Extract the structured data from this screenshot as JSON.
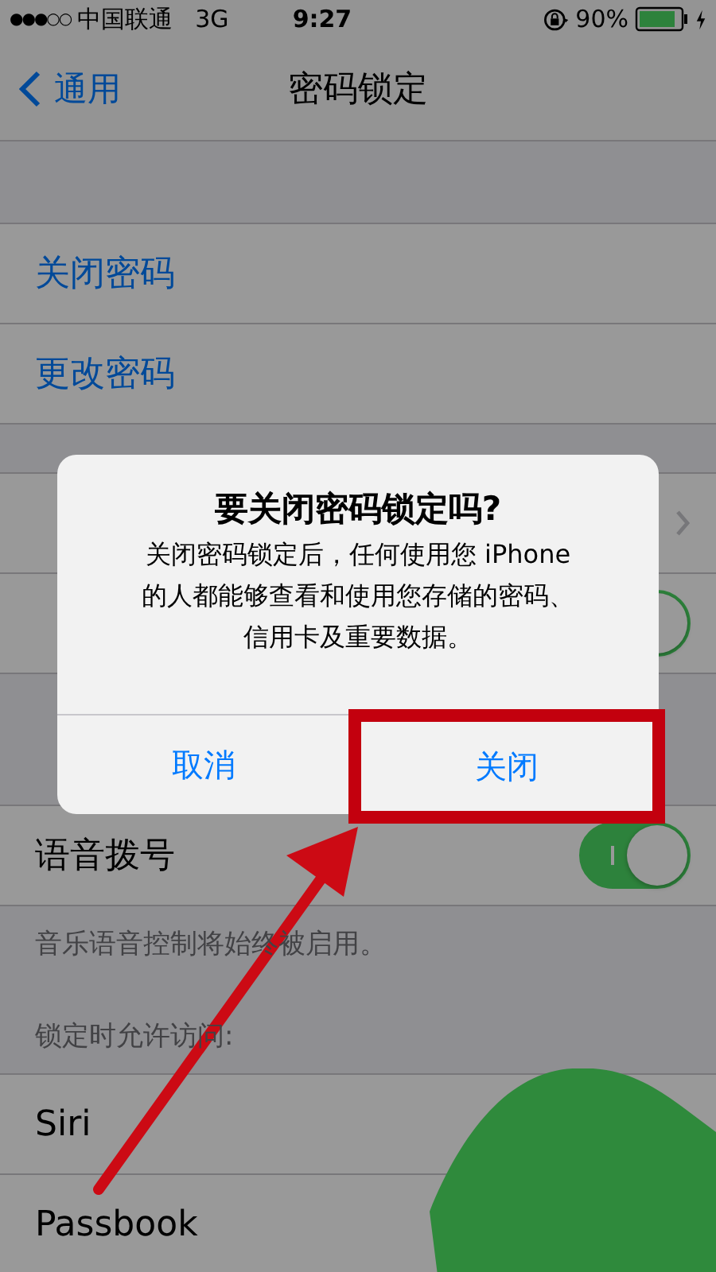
{
  "status_bar": {
    "signal": "●●●○○",
    "carrier": "中国联通",
    "network": "3G",
    "time": "9:27",
    "battery": "90%"
  },
  "nav": {
    "back": "通用",
    "title": "密码锁定"
  },
  "groups": [
    {
      "rows": [
        {
          "kind": "link",
          "label": "关闭密码"
        },
        {
          "kind": "link",
          "label": "更改密码"
        }
      ]
    },
    {
      "rows": [
        {
          "kind": "chevron"
        },
        {
          "kind": "toggle",
          "on": true
        }
      ]
    },
    {
      "rows": [
        {
          "kind": "toggle",
          "label": "语音拨号",
          "on": true
        }
      ],
      "footer": "音乐语音控制将始终被启用。"
    },
    {
      "header": "锁定时允许访问:",
      "rows": [
        {
          "kind": "plain",
          "label": "Siri"
        },
        {
          "kind": "plain",
          "label": "Passbook"
        }
      ]
    }
  ],
  "alert": {
    "title": "要关闭密码锁定吗?",
    "message_lines": [
      "关闭密码锁定后，任何使用您 iPhone",
      "的人都能够查看和使用您存储的密码、",
      "信用卡及重要数据。"
    ],
    "buttons": [
      {
        "label": "取消",
        "highlighted": false
      },
      {
        "label": "关闭",
        "highlighted": true
      }
    ]
  }
}
